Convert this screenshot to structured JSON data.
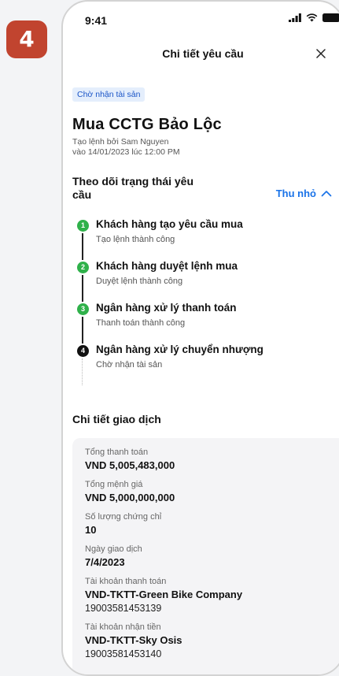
{
  "step_number": "4",
  "status_bar": {
    "time": "9:41"
  },
  "nav": {
    "title": "Chi tiết yêu cầu"
  },
  "status_chip": "Chờ nhận tài sản",
  "request": {
    "title": "Mua CCTG Bảo Lộc",
    "created_by": "Tạo lệnh bởi Sam Nguyen",
    "created_at": "vào 14/01/2023 lúc 12:00 PM"
  },
  "tracking": {
    "title": "Theo dõi trạng thái yêu cầu",
    "collapse_label": "Thu nhỏ",
    "steps": [
      {
        "num": "1",
        "title": "Khách hàng tạo yêu cầu mua",
        "subtitle": "Tạo lệnh thành công",
        "color": "#2fb14a"
      },
      {
        "num": "2",
        "title": "Khách hàng duyệt lệnh mua",
        "subtitle": "Duyệt lệnh thành công",
        "color": "#2fb14a"
      },
      {
        "num": "3",
        "title": "Ngân hàng xử lý thanh toán",
        "subtitle": "Thanh toán thành công",
        "color": "#2fb14a"
      },
      {
        "num": "4",
        "title": "Ngân hàng xử lý chuyển nhượng",
        "subtitle": "Chờ nhận tài sản",
        "color": "#111111"
      }
    ]
  },
  "details": {
    "title": "Chi tiết giao dịch",
    "rows": [
      {
        "label": "Tổng thanh toán",
        "value": "VND 5,005,483,000"
      },
      {
        "label": "Tổng mệnh giá",
        "value": "VND 5,000,000,000"
      },
      {
        "label": "Số lượng chứng chỉ",
        "value": "10"
      },
      {
        "label": "Ngày giao dịch",
        "value": "7/4/2023"
      },
      {
        "label": "Tài khoản thanh toán",
        "value": "VND-TKTT-Green Bike Company",
        "sub": "19003581453139"
      },
      {
        "label": "Tài khoản nhận tiền",
        "value": "VND-TKTT-Sky Osis",
        "sub": "19003581453140"
      }
    ]
  }
}
